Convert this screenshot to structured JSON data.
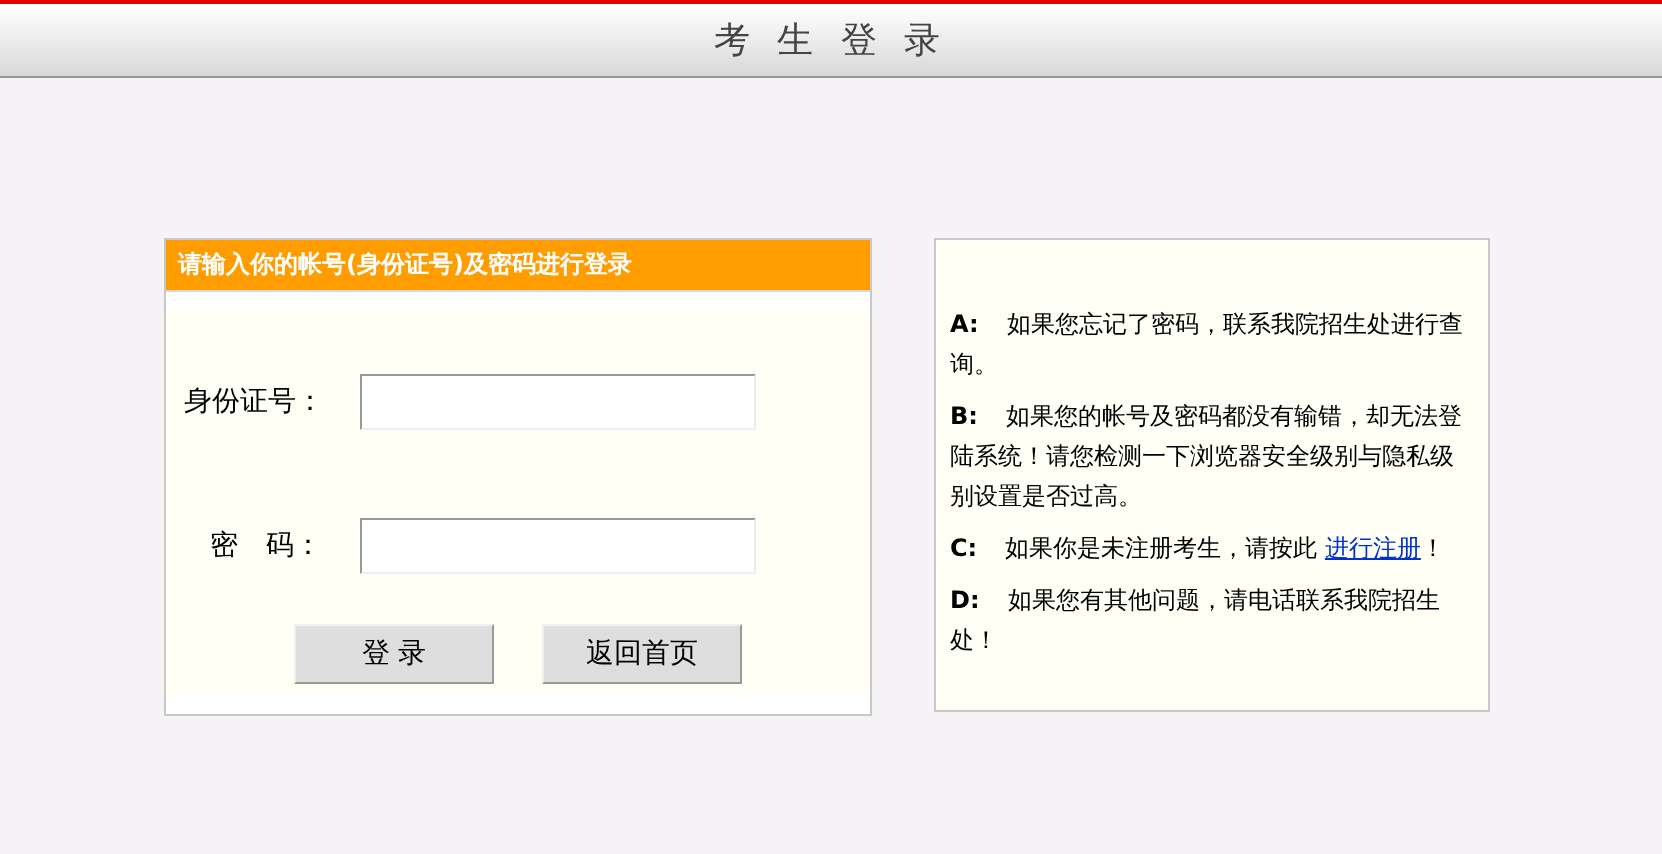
{
  "header": {
    "title": "考 生 登 录"
  },
  "login_panel": {
    "title": "请输入你的帐号(身份证号)及密码进行登录",
    "fields": [
      {
        "label": "身份证号：",
        "kind": "text"
      },
      {
        "label": "密　码：",
        "kind": "password"
      }
    ],
    "buttons": [
      "登 录",
      "返回首页"
    ]
  },
  "help": [
    {
      "letter": "A:",
      "text": "如果您忘记了密码，联系我院招生处进行查询。"
    },
    {
      "letter": "B:",
      "text": "如果您的帐号及密码都没有输错，却无法登陆系统！请您检测一下浏览器安全级别与隐私级别设置是否过高。"
    },
    {
      "letter": "C:",
      "text": "如果你是未注册考生，请按此 ",
      "link": "进行注册",
      "tail": "！"
    },
    {
      "letter": "D:",
      "text": "如果您有其他问题，请电话联系我院招生处！"
    }
  ]
}
